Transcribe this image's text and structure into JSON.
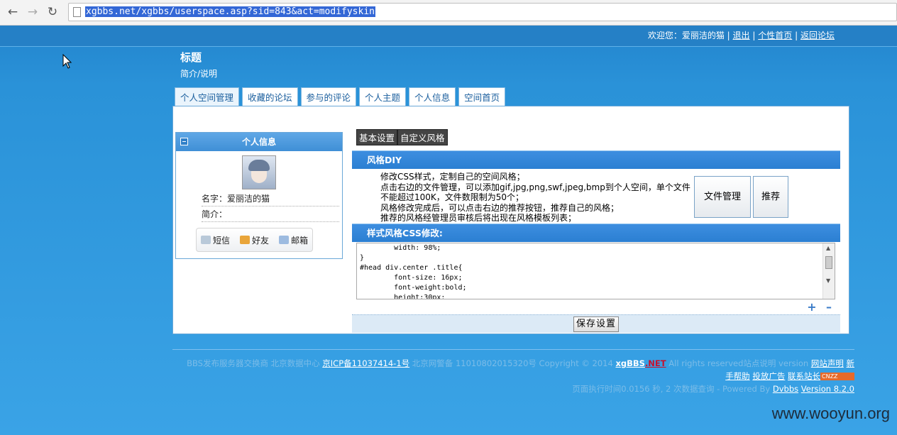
{
  "browser": {
    "back_icon": "back-arrow-icon",
    "forward_icon": "forward-arrow-icon",
    "reload_icon": "reload-icon",
    "url": "xgbbs.net/xgbbs/userspace.asp?sid=843&act=modifyskin"
  },
  "topbar": {
    "welcome": "欢迎您：爱丽洁的猫",
    "logout": "退出",
    "home": "个性首页",
    "back_forum": "返回论坛",
    "sep": "|"
  },
  "site": {
    "title": "标题",
    "subtitle": "简介/说明"
  },
  "tabs": [
    "个人空间管理",
    "收藏的论坛",
    "参与的评论",
    "个人主题",
    "个人信息",
    "空间首页"
  ],
  "profile": {
    "header": "个人信息",
    "name_label": "名字：爱丽洁的猫",
    "intro_label": "简介：",
    "actions": [
      "短信",
      "好友",
      "邮箱"
    ]
  },
  "toolbar": {
    "basic": "基本设置",
    "custom": "自定义风格"
  },
  "diy": {
    "header": "风格DIY",
    "lines": [
      "修改CSS样式，定制自己的空间风格；",
      "点击右边的文件管理，可以添加gif,jpg,png,swf,jpeg,bmp到个人空间，单个文件不能超过100K，文件数限制为50个；",
      "风格修改完成后，可以点击右边的推荐按钮，推荐自己的风格；",
      "推荐的风格经管理员审核后将出现在风格模板列表；"
    ],
    "file_button": "文件管理",
    "recommend_button": "推荐"
  },
  "css_edit": {
    "header": "样式风格CSS修改:",
    "code": "        width: 98%;\n}\n#head div.center .title{\n        font-size: 16px;\n        font-weight:bold;\n        height:30px;",
    "save_button": "保存设置"
  },
  "footer": {
    "line1_prefix": "BBS发布服务器交换商 北京数据中心",
    "icp": "京ICP备11037414-1号",
    "line1_mid": "北京网警备 11010802015320号 Copyright © 2014",
    "brand": "xgBBS",
    "brand_net": ".NET",
    "line1_suffix": "All rights reserved站点说明 version",
    "disclaimer": "网站声明",
    "new": "新",
    "line2_a": "手帮助",
    "line2_b": "投放广告",
    "line2_c": "联系站长",
    "cnzz": "CNZZ",
    "line3_prefix": "页面执行时间0.0156 秒, 2 次数据查询 - Powered By",
    "powered": "Dvbbs",
    "version": "Version 8.2.0"
  },
  "watermark": "www.wooyun.org"
}
